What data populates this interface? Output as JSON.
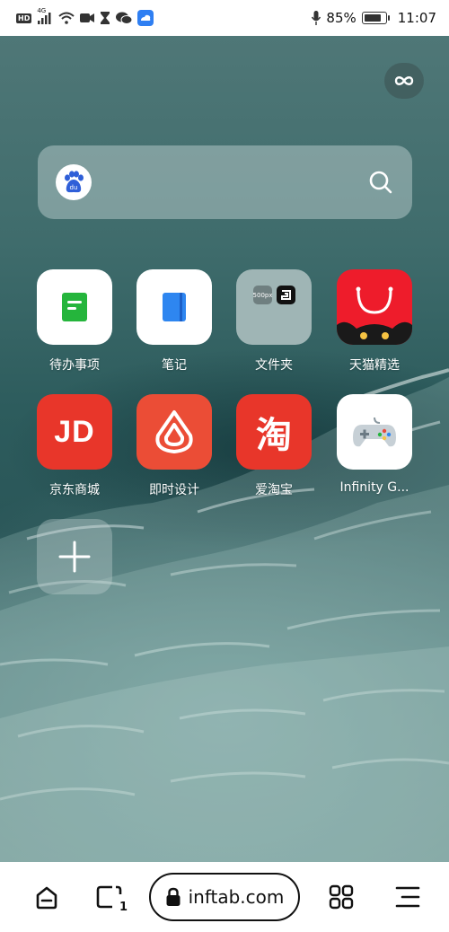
{
  "status_bar": {
    "time": "11:07",
    "battery_percent": "85%",
    "battery_level": 0.85,
    "left_icons": [
      "hd-icon",
      "signal-4g-icon",
      "wifi-icon",
      "video-icon",
      "hourglass-icon",
      "wechat-icon",
      "cloud-app-icon"
    ],
    "right_icons": [
      "microphone-icon",
      "battery-icon"
    ],
    "hd_text": "HD",
    "network_text": "4G"
  },
  "top_right": {
    "icon": "infinity-icon"
  },
  "search": {
    "placeholder": "",
    "value": "",
    "engine_icon": "baidu-logo-icon",
    "engine_logo_text": "du"
  },
  "apps": [
    {
      "label": "待办事项",
      "icon": "todo-icon",
      "tile_color": "#ffffff"
    },
    {
      "label": "笔记",
      "icon": "notes-icon",
      "tile_color": "#ffffff"
    },
    {
      "label": "文件夹",
      "icon": "folder-icon",
      "tile_color": "#9fb5b5",
      "folder_items": [
        "500px",
        "9GAG"
      ]
    },
    {
      "label": "天猫精选",
      "icon": "tmall-icon",
      "tile_color": "#ee1c2b"
    },
    {
      "label": "京东商城",
      "icon": "jd-icon",
      "tile_color": "#e8362a",
      "logo_text": "JD"
    },
    {
      "label": "即时设计",
      "icon": "js-design-icon",
      "tile_color": "#eb4d36"
    },
    {
      "label": "爱淘宝",
      "icon": "taobao-icon",
      "tile_color": "#e8362a",
      "logo_text": "淘"
    },
    {
      "label": "Infinity G...",
      "icon": "gamepad-icon",
      "tile_color": "#ffffff"
    }
  ],
  "add_button": {
    "icon": "plus-icon"
  },
  "bottom_bar": {
    "url": "inftab.com",
    "tab_count": "1",
    "buttons": [
      "home-icon",
      "tabs-icon",
      "lock-icon",
      "grid-icon",
      "menu-icon"
    ]
  },
  "colors": {
    "wallpaper_teal": "#2d5c5d",
    "jd_red": "#e8362a",
    "tmall_red": "#ee1c2b",
    "notes_blue": "#2e86f0",
    "todo_green": "#25b53c"
  }
}
